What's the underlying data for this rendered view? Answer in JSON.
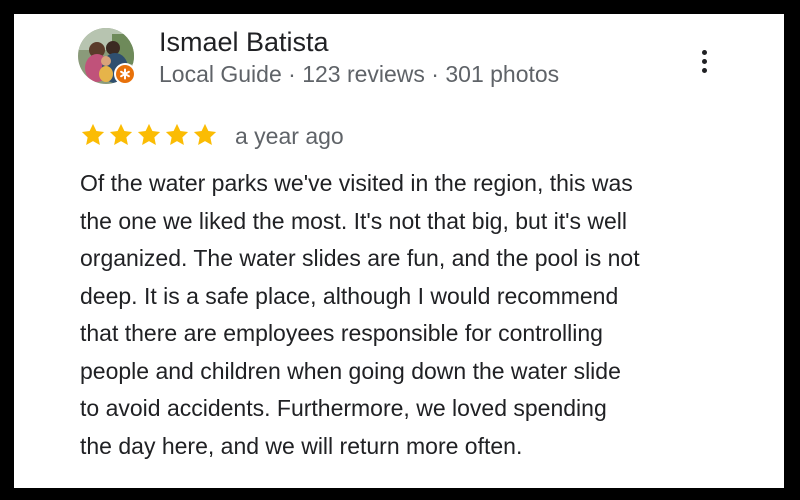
{
  "review": {
    "author": {
      "name": "Ismael Batista",
      "meta": "Local Guide · 123 reviews · 301 photos",
      "avatar_icon": "user-photo",
      "badge_icon": "local-guide-badge-icon",
      "badge_color": "#e8710a"
    },
    "menu_icon": "more-vert-icon",
    "rating": {
      "stars": 5,
      "max": 5,
      "star_color": "#fbbc04"
    },
    "date": "a year ago",
    "text_lines": [
      "Of the water parks we've visited in the region, this was",
      "the one we liked the most. It's not that big, but it's well",
      "organized. The water slides are fun, and the pool is not",
      "deep. It is a safe place, although I would recommend",
      "that there are employees responsible for controlling",
      "people and children when going down the water slide",
      "to avoid accidents. Furthermore, we loved spending",
      "the day here, and we will return more often."
    ]
  }
}
